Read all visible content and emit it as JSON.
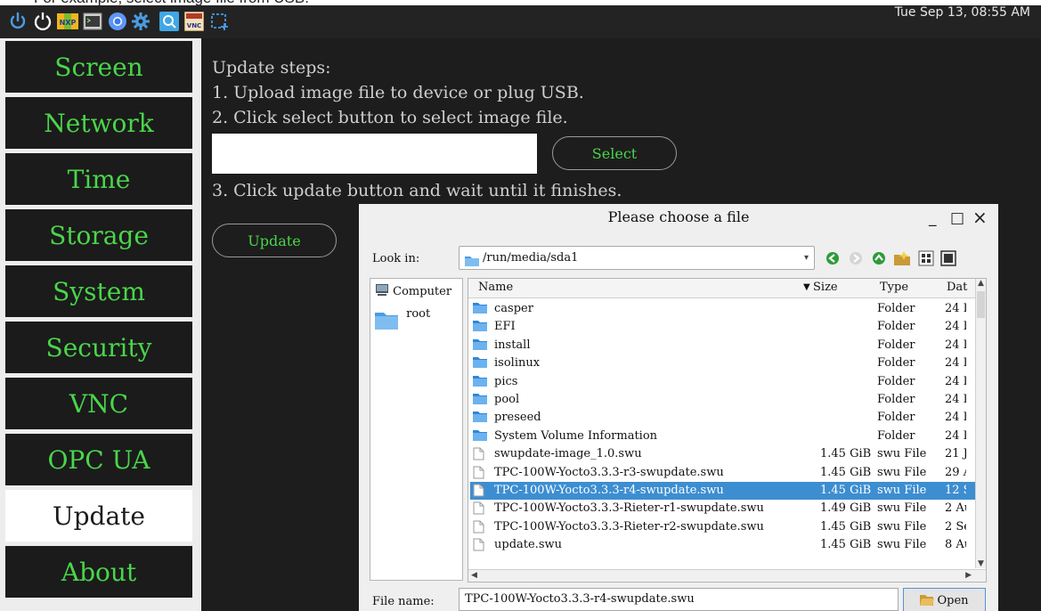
{
  "caption": "For example, select image file from USB.",
  "taskbar": {
    "icons": [
      "power-icon",
      "logout-icon",
      "nxp-logo-icon",
      "terminal-icon",
      "chromium-icon",
      "settings-gear-icon",
      "search-app-icon",
      "tightvnc-icon",
      "screenshot-region-icon"
    ],
    "nxp_label": "NXP",
    "vnc_label": "VNC",
    "clock": "Tue Sep 13, 08:55 AM"
  },
  "sidebar": {
    "items": [
      {
        "label": "Screen"
      },
      {
        "label": "Network"
      },
      {
        "label": "Time"
      },
      {
        "label": "Storage"
      },
      {
        "label": "System"
      },
      {
        "label": "Security"
      },
      {
        "label": "VNC"
      },
      {
        "label": "OPC UA"
      },
      {
        "label": "Update",
        "active": true
      },
      {
        "label": "About"
      }
    ]
  },
  "main": {
    "heading": "Update steps:",
    "step1": "1. Upload image file to device or plug USB.",
    "step2": "2. Click select button to select image file.",
    "path_value": "",
    "select_label": "Select",
    "step3": "3. Click update button and wait until it finishes.",
    "update_label": "Update"
  },
  "dialog": {
    "title": "Please choose a file",
    "minimize": "_",
    "maximize": "□",
    "close": "×",
    "look_in_label": "Look in:",
    "look_in_value": "/run/media/sda1",
    "sidebar": {
      "computer": "Computer",
      "root": "root"
    },
    "columns": {
      "name": "Name",
      "size": "Size",
      "type": "Type",
      "date": "Dat"
    },
    "rows": [
      {
        "name": "casper",
        "size": "",
        "type": "Folder",
        "date": "24 I",
        "kind": "folder"
      },
      {
        "name": "EFI",
        "size": "",
        "type": "Folder",
        "date": "24 I",
        "kind": "folder"
      },
      {
        "name": "install",
        "size": "",
        "type": "Folder",
        "date": "24 I",
        "kind": "folder"
      },
      {
        "name": "isolinux",
        "size": "",
        "type": "Folder",
        "date": "24 I",
        "kind": "folder"
      },
      {
        "name": "pics",
        "size": "",
        "type": "Folder",
        "date": "24 I",
        "kind": "folder"
      },
      {
        "name": "pool",
        "size": "",
        "type": "Folder",
        "date": "24 I",
        "kind": "folder"
      },
      {
        "name": "preseed",
        "size": "",
        "type": "Folder",
        "date": "24 I",
        "kind": "folder"
      },
      {
        "name": "System Volume Information",
        "size": "",
        "type": "Folder",
        "date": "24 I",
        "kind": "folder"
      },
      {
        "name": "swupdate-image_1.0.swu",
        "size": "1.45 GiB",
        "type": "swu File",
        "date": "21 J",
        "kind": "file"
      },
      {
        "name": "TPC-100W-Yocto3.3.3-r3-swupdate.swu",
        "size": "1.45 GiB",
        "type": "swu File",
        "date": "29 A",
        "kind": "file"
      },
      {
        "name": "TPC-100W-Yocto3.3.3-r4-swupdate.swu",
        "size": "1.45 GiB",
        "type": "swu File",
        "date": "12 S",
        "kind": "file",
        "selected": true
      },
      {
        "name": "TPC-100W-Yocto3.3.3-Rieter-r1-swupdate.swu",
        "size": "1.49 GiB",
        "type": "swu File",
        "date": "2 Au",
        "kind": "file"
      },
      {
        "name": "TPC-100W-Yocto3.3.3-Rieter-r2-swupdate.swu",
        "size": "1.45 GiB",
        "type": "swu File",
        "date": "2 Se",
        "kind": "file"
      },
      {
        "name": "update.swu",
        "size": "1.45 GiB",
        "type": "swu File",
        "date": "8 Au",
        "kind": "file"
      }
    ],
    "file_name_label": "File name:",
    "file_name_value": "TPC-100W-Yocto3.3.3-r4-swupdate.swu",
    "open_label": "Open"
  },
  "colors": {
    "accent_green": "#49d64a",
    "selection_blue": "#3d8ed1",
    "panel_dark": "#1d1d1d"
  }
}
